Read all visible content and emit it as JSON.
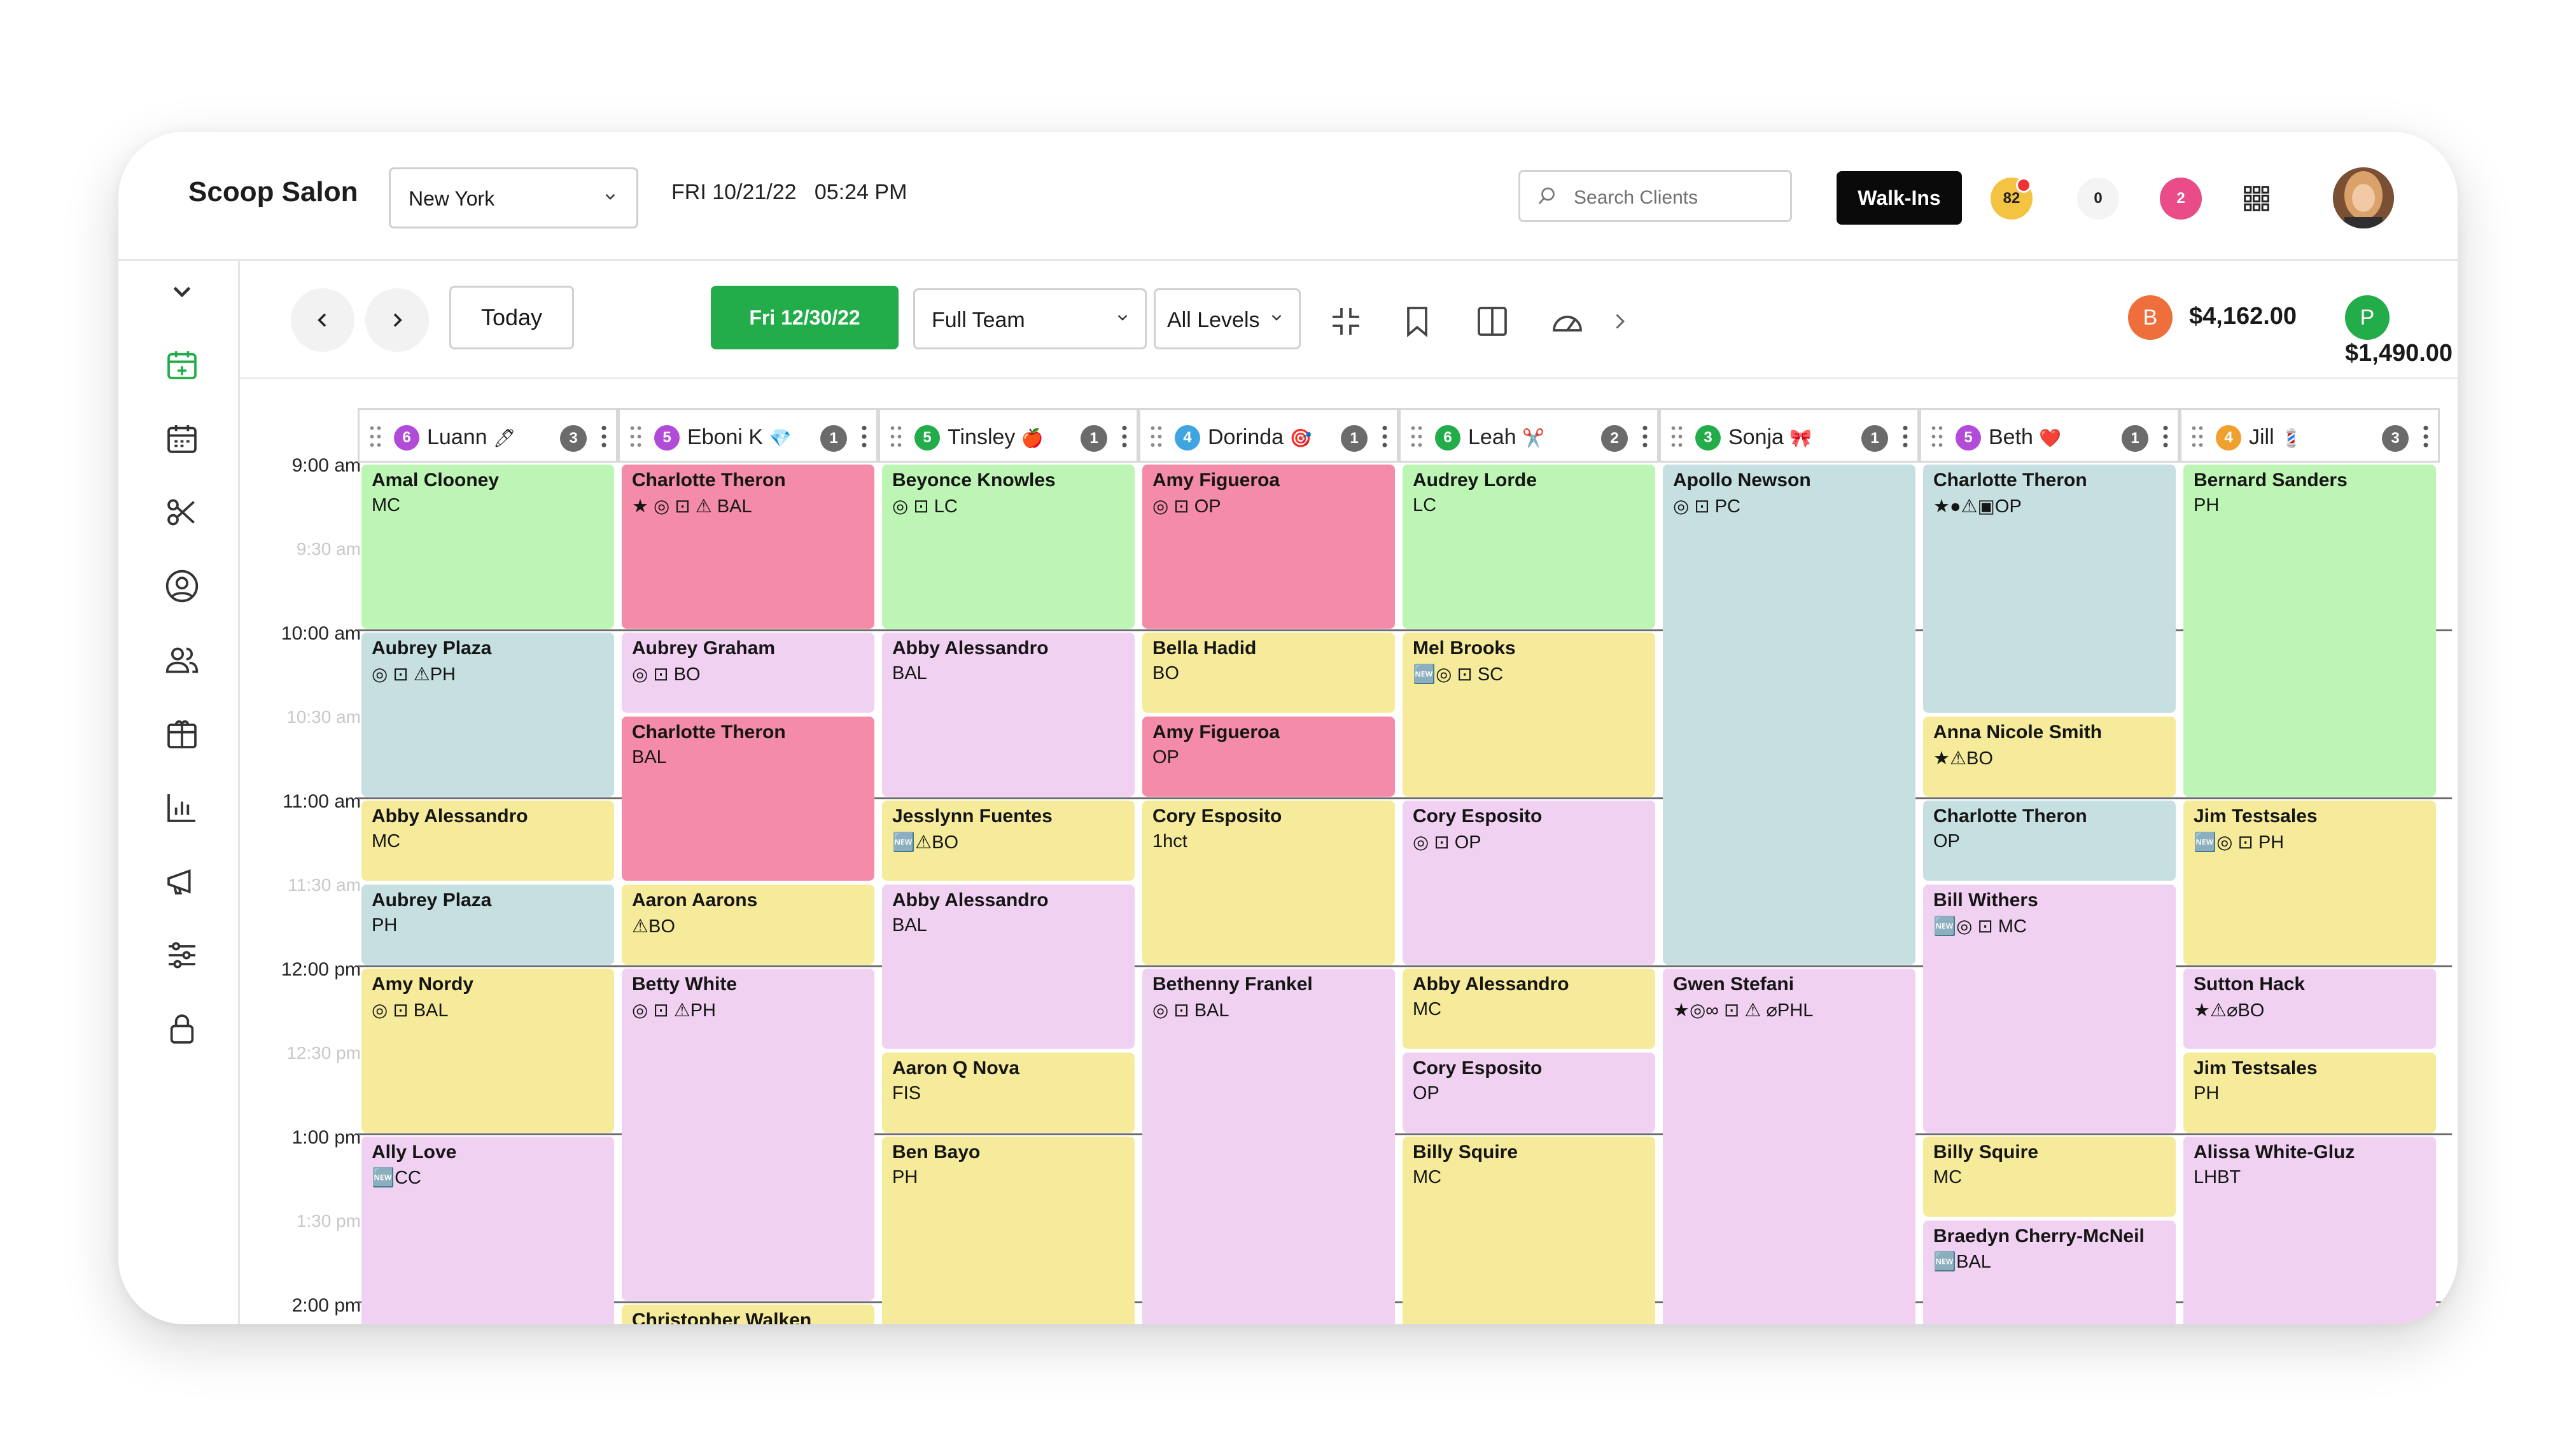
{
  "header": {
    "brand": "Scoop Salon",
    "location": "New York",
    "datetime": "FRI 10/21/22   05:24 PM",
    "search_placeholder": "Search Clients",
    "walkins_label": "Walk-Ins",
    "badges": [
      "82",
      "0",
      "2"
    ]
  },
  "sidebar": {
    "icons": [
      "collapse-chevron-icon",
      "add-calendar-icon",
      "calendar-icon",
      "scissors-icon",
      "user-circle-icon",
      "users-icon",
      "package-icon",
      "bar-chart-icon",
      "megaphone-icon",
      "sliders-icon",
      "lock-icon"
    ]
  },
  "toolbar": {
    "today_label": "Today",
    "date_label": "Fri 12/30/22",
    "team_select": "Full Team",
    "levels_select": "All Levels",
    "money": [
      {
        "badge": "B",
        "amount": "$4,162.00",
        "color": "#ee6f3b"
      },
      {
        "badge": "P",
        "amount": "$1,490.00",
        "color": "#23ad4a"
      }
    ]
  },
  "times": [
    "9:00 am",
    "9:30 am",
    "10:00 am",
    "10:30 am",
    "11:00 am",
    "11:30 am",
    "12:00 pm",
    "12:30 pm",
    "1:00 pm",
    "1:30 pm",
    "2:00 pm"
  ],
  "columns": [
    {
      "name": "Luann",
      "emoji": "🖊",
      "count": "6",
      "count_color": "#b24bd8",
      "badge": "3",
      "appointments": [
        {
          "client": "Amal Clooney",
          "service": "MC",
          "start": 0,
          "dur": 2,
          "color": "green"
        },
        {
          "client": "Aubrey Plaza",
          "service": "◎ ⊡ ⚠PH",
          "start": 2,
          "dur": 2,
          "color": "blue"
        },
        {
          "client": "Abby Alessandro",
          "service": "MC",
          "start": 4,
          "dur": 1,
          "color": "yellow"
        },
        {
          "client": "Aubrey Plaza",
          "service": "PH",
          "start": 5,
          "dur": 1,
          "color": "blue"
        },
        {
          "client": "Amy Nordy",
          "service": "◎ ⊡ BAL",
          "start": 6,
          "dur": 2,
          "color": "yellow"
        },
        {
          "client": "Ally Love",
          "service": "🆕CC",
          "start": 8,
          "dur": 3,
          "color": "lav"
        }
      ]
    },
    {
      "name": "Eboni K",
      "emoji": "💎",
      "count": "5",
      "count_color": "#b24bd8",
      "badge": "1",
      "appointments": [
        {
          "client": "Charlotte Theron",
          "service": "★ ◎ ⊡ ⚠ BAL",
          "start": 0,
          "dur": 2,
          "color": "pink"
        },
        {
          "client": "Aubrey Graham",
          "service": "◎ ⊡ BO",
          "start": 2,
          "dur": 1,
          "color": "lav"
        },
        {
          "client": "Charlotte Theron",
          "service": "BAL",
          "start": 3,
          "dur": 2,
          "color": "pink"
        },
        {
          "client": "Aaron Aarons",
          "service": "⚠BO",
          "start": 5,
          "dur": 1,
          "color": "yellow"
        },
        {
          "client": "Betty White",
          "service": "◎ ⊡ ⚠PH",
          "start": 6,
          "dur": 4,
          "color": "lav"
        },
        {
          "client": "Christopher Walken",
          "service": "",
          "start": 10,
          "dur": 1,
          "color": "yellow"
        }
      ]
    },
    {
      "name": "Tinsley",
      "emoji": "🍎",
      "count": "5",
      "count_color": "#23ad4a",
      "badge": "1",
      "appointments": [
        {
          "client": "Beyonce Knowles",
          "service": "◎ ⊡ LC",
          "start": 0,
          "dur": 2,
          "color": "green"
        },
        {
          "client": "Abby Alessandro",
          "service": "BAL",
          "start": 2,
          "dur": 2,
          "color": "lav"
        },
        {
          "client": "Jesslynn Fuentes",
          "service": "🆕⚠BO",
          "start": 4,
          "dur": 1,
          "color": "yellow"
        },
        {
          "client": "Abby Alessandro",
          "service": "BAL",
          "start": 5,
          "dur": 2,
          "color": "lav"
        },
        {
          "client": "Aaron Q Nova",
          "service": "FIS",
          "start": 7,
          "dur": 1,
          "color": "yellow"
        },
        {
          "client": "Ben Bayo",
          "service": "PH",
          "start": 8,
          "dur": 3,
          "color": "yellow"
        }
      ]
    },
    {
      "name": "Dorinda",
      "emoji": "🎯",
      "count": "4",
      "count_color": "#3fa5e0",
      "badge": "1",
      "appointments": [
        {
          "client": "Amy Figueroa",
          "service": "◎ ⊡ OP",
          "start": 0,
          "dur": 2,
          "color": "pink"
        },
        {
          "client": "Bella Hadid",
          "service": "BO",
          "start": 2,
          "dur": 1,
          "color": "yellow"
        },
        {
          "client": "Amy Figueroa",
          "service": "OP",
          "start": 3,
          "dur": 1,
          "color": "pink"
        },
        {
          "client": "Cory Esposito",
          "service": "1hct",
          "start": 4,
          "dur": 2,
          "color": "yellow"
        },
        {
          "client": "Bethenny Frankel",
          "service": "◎ ⊡ BAL",
          "start": 6,
          "dur": 5,
          "color": "lav"
        }
      ]
    },
    {
      "name": "Leah",
      "emoji": "✂️",
      "count": "6",
      "count_color": "#23ad4a",
      "badge": "2",
      "appointments": [
        {
          "client": "Audrey Lorde",
          "service": "LC",
          "start": 0,
          "dur": 2,
          "color": "green"
        },
        {
          "client": "Mel Brooks",
          "service": "🆕◎ ⊡ SC",
          "start": 2,
          "dur": 2,
          "color": "yellow"
        },
        {
          "client": "Cory Esposito",
          "service": "◎ ⊡ OP",
          "start": 4,
          "dur": 2,
          "color": "lav"
        },
        {
          "client": "Abby Alessandro",
          "service": "MC",
          "start": 6,
          "dur": 1,
          "color": "yellow"
        },
        {
          "client": "Cory Esposito",
          "service": "OP",
          "start": 7,
          "dur": 1,
          "color": "lav"
        },
        {
          "client": "Billy Squire",
          "service": "MC",
          "start": 8,
          "dur": 3,
          "color": "yellow"
        }
      ]
    },
    {
      "name": "Sonja",
      "emoji": "🎀",
      "count": "3",
      "count_color": "#23ad4a",
      "badge": "1",
      "appointments": [
        {
          "client": "Apollo Newson",
          "service": "◎ ⊡ PC",
          "start": 0,
          "dur": 6,
          "color": "blue"
        },
        {
          "client": "Gwen Stefani",
          "service": "★◎∞ ⊡ ⚠ ⌀PHL",
          "start": 6,
          "dur": 5,
          "color": "lav"
        }
      ]
    },
    {
      "name": "Beth",
      "emoji": "❤️",
      "count": "5",
      "count_color": "#b24bd8",
      "badge": "1",
      "appointments": [
        {
          "client": "Charlotte Theron",
          "service": "★●⚠▣OP",
          "start": 0,
          "dur": 3,
          "color": "blue"
        },
        {
          "client": "Anna Nicole Smith",
          "service": "★⚠BO",
          "start": 3,
          "dur": 1,
          "color": "yellow"
        },
        {
          "client": "Charlotte Theron",
          "service": "OP",
          "start": 4,
          "dur": 1,
          "color": "blue"
        },
        {
          "client": "Bill Withers",
          "service": "🆕◎ ⊡ MC",
          "start": 5,
          "dur": 3,
          "color": "lav"
        },
        {
          "client": "Billy Squire",
          "service": "MC",
          "start": 8,
          "dur": 1,
          "color": "yellow"
        },
        {
          "client": "Braedyn Cherry-McNeil",
          "service": "🆕BAL",
          "start": 9,
          "dur": 2,
          "color": "lav"
        }
      ]
    },
    {
      "name": "Jill",
      "emoji": "💈",
      "count": "4",
      "count_color": "#f0a02c",
      "badge": "3",
      "appointments": [
        {
          "client": "Bernard Sanders",
          "service": "PH",
          "start": 0,
          "dur": 4,
          "color": "green"
        },
        {
          "client": "Jim Testsales",
          "service": "🆕◎ ⊡ PH",
          "start": 4,
          "dur": 2,
          "color": "yellow"
        },
        {
          "client": "Sutton Hack",
          "service": "★⚠⌀BO",
          "start": 6,
          "dur": 1,
          "color": "lav"
        },
        {
          "client": "Jim Testsales",
          "service": "PH",
          "start": 7,
          "dur": 1,
          "color": "yellow"
        },
        {
          "client": "Alissa White-Gluz",
          "service": "LHBT",
          "start": 8,
          "dur": 3,
          "color": "lav"
        }
      ]
    }
  ]
}
